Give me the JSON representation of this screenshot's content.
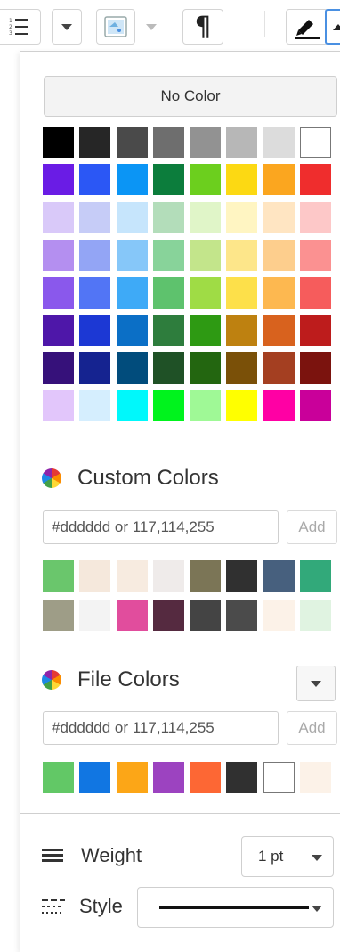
{
  "toolbar": {
    "para_glyph": "¶",
    "list_icon": "list-icon",
    "fill_icon": "fill-color-icon",
    "paragraph_icon": "paragraph-icon",
    "line_color_icon": "line-color-icon"
  },
  "panel": {
    "no_color_label": "No Color",
    "palette": [
      [
        "#000000",
        "#262626",
        "#4a4a4a",
        "#6e6e6e",
        "#929292",
        "#b7b7b7",
        "#dcdcdc",
        "#ffffff"
      ],
      [
        "#6a1ce5",
        "#2b57f5",
        "#0b95f5",
        "#0c7d3c",
        "#6ccf1e",
        "#fcd913",
        "#fba61f",
        "#ef2d2d"
      ],
      [
        "#d9c9f9",
        "#c6ccf7",
        "#c6e5fc",
        "#b3ddba",
        "#e0f5c8",
        "#fff5c2",
        "#ffe5c2",
        "#fdc8c8"
      ],
      [
        "#b48ff0",
        "#93a5f5",
        "#86c7f9",
        "#88d39a",
        "#c3e58b",
        "#fde68a",
        "#fdce8d",
        "#fb9191"
      ],
      [
        "#8a58ec",
        "#5275f5",
        "#3eaaf7",
        "#5ec26d",
        "#9fdc45",
        "#fde04a",
        "#fdb850",
        "#f65c5c"
      ],
      [
        "#4e17a9",
        "#1c38d4",
        "#0b6fc6",
        "#2e7d3d",
        "#2e9a13",
        "#be8110",
        "#d8621e",
        "#bd1c1c"
      ],
      [
        "#36117a",
        "#152390",
        "#014c7c",
        "#1f5126",
        "#236610",
        "#7a5008",
        "#a43f21",
        "#7b130e"
      ],
      [
        "#e2c6fb",
        "#d5eefe",
        "#00f8fb",
        "#00f31d",
        "#9ff996",
        "#ffff00",
        "#ff00a4",
        "#c9009a"
      ]
    ],
    "custom_colors_title": "Custom Colors",
    "custom_input_placeholder": "#dddddd or 117,114,255",
    "custom_add_label": "Add",
    "custom_swatches": [
      "#6ac66c",
      "#f5e8dc",
      "#f7ebe0",
      "#efebea",
      "#7b7556",
      "#303030",
      "#47607e",
      "#32a97a",
      "#9e9d87",
      "#f3f3f3",
      "#e14d9d",
      "#552a40",
      "#444444",
      "#4b4b4b",
      "#fcf2e8",
      "#e0f3e1"
    ],
    "file_colors_title": "File Colors",
    "file_input_placeholder": "#dddddd or 117,114,255",
    "file_add_label": "Add",
    "file_swatches": [
      "#62c866",
      "#1176e2",
      "#fca617",
      "#9c43c0",
      "#fd6734",
      "#303030",
      "#ffffff",
      "#fcf2e8"
    ],
    "weight_label": "Weight",
    "weight_value": "1 pt",
    "style_label": "Style"
  }
}
